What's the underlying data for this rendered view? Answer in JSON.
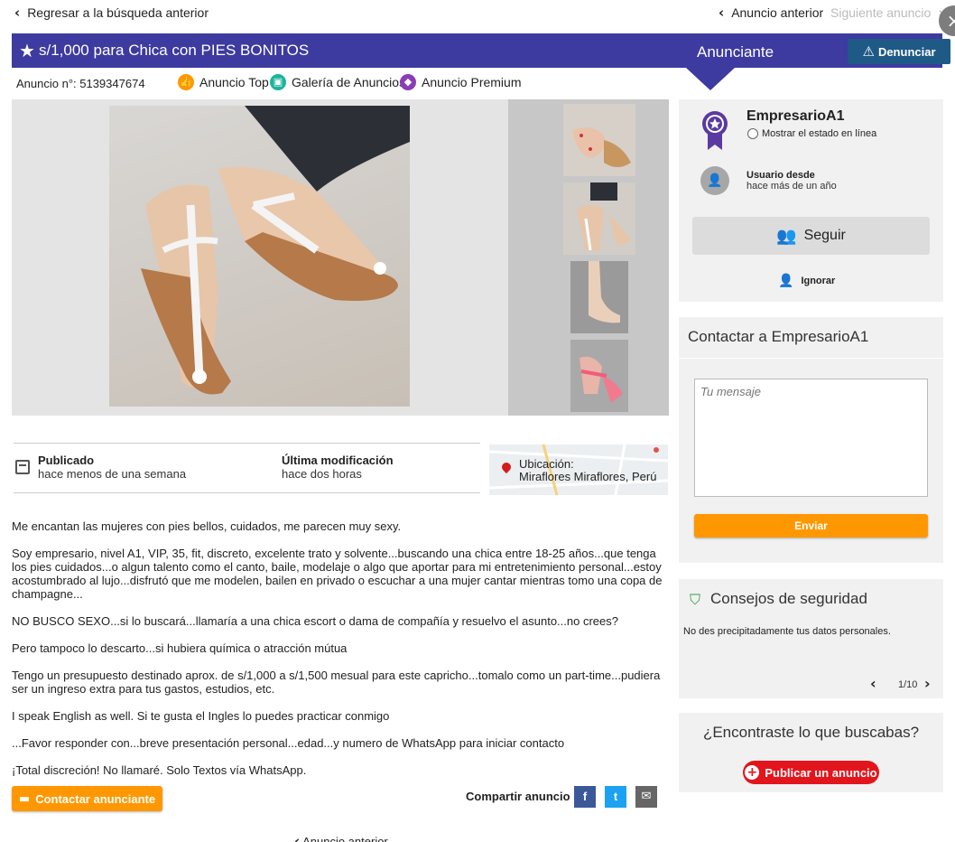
{
  "nav": {
    "back_label": "Regresar a la búsqueda anterior",
    "prev_label": "Anuncio anterior",
    "next_label": "Siguiente anuncio",
    "close_symbol": "×"
  },
  "title_bar": {
    "title": "s/1,000 para Chica con PIES BONITOS",
    "advertiser_label": "Anunciante",
    "report_label": "Denunciar"
  },
  "meta": {
    "ad_number": "Anuncio n°: 5139347674",
    "badges": [
      "Anuncio Top",
      "Galería de Anuncios",
      "Anuncio Premium"
    ]
  },
  "gallery": {
    "thumbnail_count": 4
  },
  "info": {
    "published_label": "Publicado",
    "published_value": "hace menos de una semana",
    "modified_label": "Última modificación",
    "modified_value": "hace dos horas",
    "location_label": "Ubicación:",
    "location_value": "Miraflores Miraflores, Perú"
  },
  "description": [
    "Me encantan las mujeres con pies bellos, cuidados, me parecen muy sexy.",
    "Soy empresario, nivel A1, VIP, 35, fit, discreto, excelente trato y solvente...buscando una chica entre 18-25 años...que tenga los pies cuidados...o algun talento como el canto, baile, modelaje o algo que aportar para mi entretenimiento personal...estoy acostumbrado al lujo...disfrutó que me modelen, bailen en privado o escuchar a una mujer cantar mientras tomo una copa de champagne...",
    "NO BUSCO SEXO...si lo buscará...llamaría a una chica escort o dama de compañía y resuelvo el asunto...no crees?",
    "Pero tampoco lo descarto...si hubiera química o atracción mútua",
    "Tengo un presupuesto destinado aprox. de s/1,000 a s/1,500 mesual para este capricho...tomalo como un part-time...pudiera ser un ingreso extra para tus gastos, estudios, etc.",
    "I speak English as well. Si te gusta el Ingles lo puedes practicar conmigo",
    "...Favor responder con...breve presentación personal...edad...y numero de WhatsApp para iniciar contacto",
    "¡Total discreción! No llamaré. Solo Textos vía WhatsApp."
  ],
  "actions": {
    "contact_label": "Contactar anunciante",
    "share_label": "Compartir anuncio",
    "share_facebook": "f",
    "share_twitter": "t",
    "share_email": "✉",
    "bottom_prev": "Anuncio anterior"
  },
  "seller": {
    "name": "EmpresarioA1",
    "online_label": "Mostrar el estado en línea",
    "since_label": "Usuario desde",
    "since_value": "hace más de un año",
    "follow_label": "Seguir",
    "ignore_label": "Ignorar"
  },
  "contact": {
    "title": "Contactar a EmpresarioA1",
    "message_placeholder": "Tu mensaje",
    "send_label": "Enviar"
  },
  "safety": {
    "title": "Consejos de seguridad",
    "tip": "No des precipitadamente tus datos personales.",
    "pager": "1/10"
  },
  "found": {
    "title": "¿Encontraste lo que buscabas?",
    "publish_label": "Publicar un anuncio"
  },
  "colors": {
    "title_bar": "#3d3aa0",
    "orange": "#ff9800",
    "report": "#1f5a86",
    "publish": "#e3151c",
    "facebook": "#3b5998",
    "twitter": "#1da1f2",
    "email": "#666666"
  }
}
